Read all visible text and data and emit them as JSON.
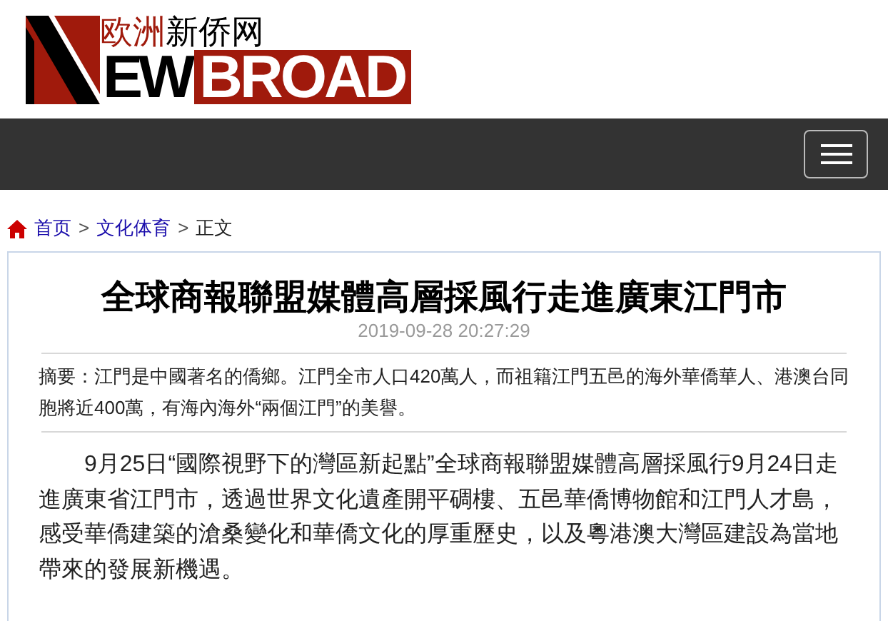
{
  "logo": {
    "chinese_red": "欧洲",
    "chinese_black": "新侨网",
    "word_black": "EW",
    "word_red": "BROAD"
  },
  "breadcrumb": [
    {
      "label": "首页",
      "kind": "link"
    },
    {
      "label": ">",
      "kind": "separator"
    },
    {
      "label": "文化体育",
      "kind": "link"
    },
    {
      "label": ">",
      "kind": "separator"
    },
    {
      "label": "正文",
      "kind": "current"
    }
  ],
  "article": {
    "title": "全球商報聯盟媒體高層採風行走進廣東江門市",
    "date": "2019-09-28 20:27:29",
    "summary": "摘要：江門是中國著名的僑鄉。江門全市人口420萬人，而祖籍江門五邑的海外華僑華人、港澳台同胞將近400萬，有海內海外“兩個江門”的美譽。",
    "body": "9月25日“國際視野下的灣區新起點”全球商報聯盟媒體高層採風行9月24日走進廣東省江門市，透過世界文化遺產開平碉樓、五邑華僑博物館和江門人才島，感受華僑建築的滄桑變化和華僑文化的厚重歷史，以及粵港澳大灣區建設為當地帶來的發展新機遇。"
  }
}
